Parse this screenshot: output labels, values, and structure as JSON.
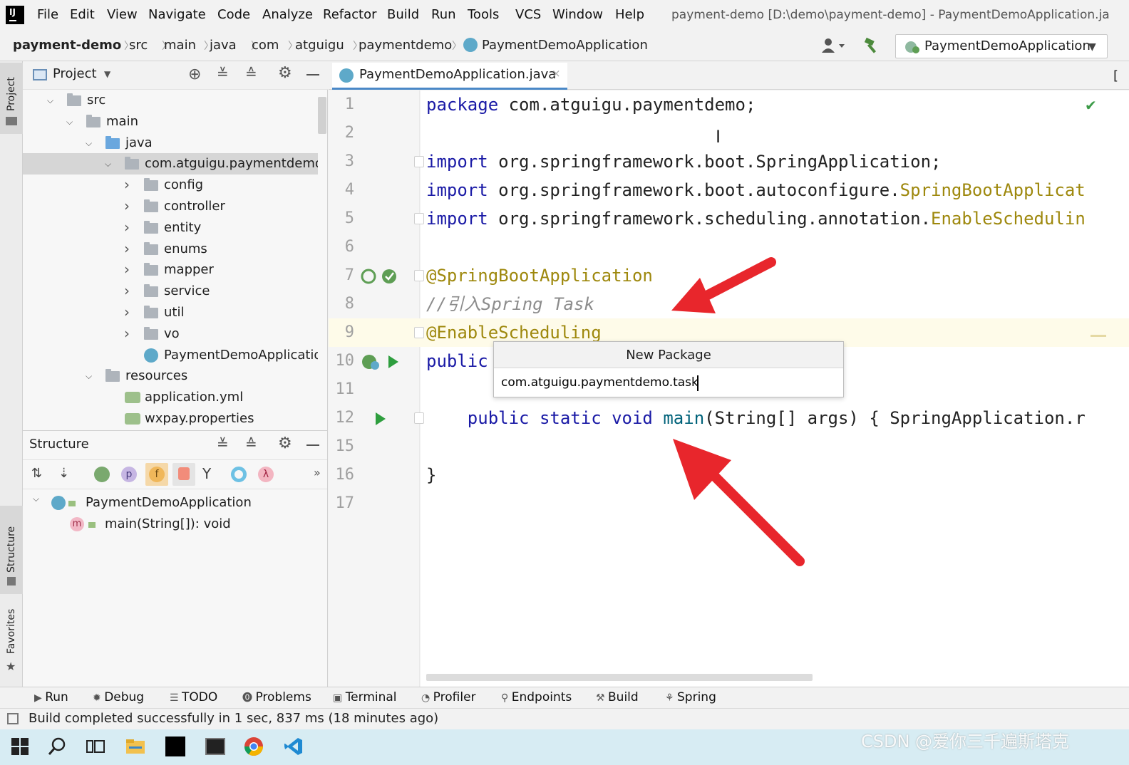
{
  "app": {
    "logo": "IJ",
    "window_title": "payment-demo [D:\\demo\\payment-demo] - PaymentDemoApplication.ja"
  },
  "menu": [
    "File",
    "Edit",
    "View",
    "Navigate",
    "Code",
    "Analyze",
    "Refactor",
    "Build",
    "Run",
    "Tools",
    "VCS",
    "Window",
    "Help"
  ],
  "breadcrumbs": [
    "payment-demo",
    "src",
    "main",
    "java",
    "com",
    "atguigu",
    "paymentdemo",
    "PaymentDemoApplication"
  ],
  "run_config": {
    "label": "PaymentDemoApplication"
  },
  "side_tabs": {
    "project": "Project",
    "structure": "Structure",
    "favorites": "Favorites"
  },
  "project_panel": {
    "title": "Project",
    "tree": [
      {
        "label": "src",
        "depth": 0,
        "expanded": true,
        "kind": "folder"
      },
      {
        "label": "main",
        "depth": 1,
        "expanded": true,
        "kind": "folder"
      },
      {
        "label": "java",
        "depth": 2,
        "expanded": true,
        "kind": "folder-blue"
      },
      {
        "label": "com.atguigu.paymentdemo",
        "depth": 3,
        "expanded": true,
        "kind": "package",
        "selected": true
      },
      {
        "label": "config",
        "depth": 4,
        "expanded": false,
        "kind": "package"
      },
      {
        "label": "controller",
        "depth": 4,
        "expanded": false,
        "kind": "package"
      },
      {
        "label": "entity",
        "depth": 4,
        "expanded": false,
        "kind": "package"
      },
      {
        "label": "enums",
        "depth": 4,
        "expanded": false,
        "kind": "package"
      },
      {
        "label": "mapper",
        "depth": 4,
        "expanded": false,
        "kind": "package"
      },
      {
        "label": "service",
        "depth": 4,
        "expanded": false,
        "kind": "package"
      },
      {
        "label": "util",
        "depth": 4,
        "expanded": false,
        "kind": "package"
      },
      {
        "label": "vo",
        "depth": 4,
        "expanded": false,
        "kind": "package"
      },
      {
        "label": "PaymentDemoApplicatio",
        "depth": 4,
        "kind": "class"
      },
      {
        "label": "resources",
        "depth": 2,
        "expanded": true,
        "kind": "folder"
      },
      {
        "label": "application.yml",
        "depth": 3,
        "kind": "yml"
      },
      {
        "label": "wxpay.properties",
        "depth": 3,
        "kind": "properties"
      }
    ]
  },
  "structure_panel": {
    "title": "Structure",
    "root": "PaymentDemoApplication",
    "child": "main(String[]): void",
    "filter_letters": [
      "p",
      "f",
      "λ"
    ],
    "method_badge": "m"
  },
  "editor": {
    "tab_label": "PaymentDemoApplication.java",
    "lines": [
      {
        "n": "1",
        "html": "<span class='kw'>package</span> com.atguigu.paymentdemo;"
      },
      {
        "n": "2",
        "html": ""
      },
      {
        "n": "3",
        "html": "<span class='kw'>import</span> org.springframework.boot.SpringApplication;"
      },
      {
        "n": "4",
        "html": "<span class='kw'>import</span> org.springframework.boot.autoconfigure.<span class='ann'>SpringBootApplicat</span>"
      },
      {
        "n": "5",
        "html": "<span class='kw'>import</span> org.springframework.scheduling.annotation.<span class='ann'>EnableSchedulin</span>"
      },
      {
        "n": "6",
        "html": ""
      },
      {
        "n": "7",
        "html": "<span class='ann'>@SpringBootApplication</span>"
      },
      {
        "n": "8",
        "html": "<span class='cm'>//引入Spring Task</span>"
      },
      {
        "n": "9",
        "html": "<span class='ann'>@EnableScheduling</span>"
      },
      {
        "n": "10",
        "html": "<span class='kw'>public</span>"
      },
      {
        "n": "11",
        "html": ""
      },
      {
        "n": "12",
        "html": "    <span class='kw'>public static void</span> <span class='fn'>main</span>(String[] args) { SpringApplication.r"
      },
      {
        "n": "15",
        "html": ""
      },
      {
        "n": "16",
        "html": "}"
      },
      {
        "n": "17",
        "html": ""
      }
    ]
  },
  "new_package_dialog": {
    "title": "New Package",
    "value": "com.atguigu.paymentdemo.task"
  },
  "tool_windows": [
    "Run",
    "Debug",
    "TODO",
    "Problems",
    "Terminal",
    "Profiler",
    "Endpoints",
    "Build",
    "Spring"
  ],
  "status": {
    "text": "Build completed successfully in 1 sec, 837 ms (18 minutes ago)"
  },
  "watermark": "CSDN @爱你三千遍斯塔克",
  "colors": {
    "arrow": "#e8262c",
    "keyword": "#1a1aa6",
    "annotation": "#9e880d",
    "selection": "#d6d6d6"
  }
}
